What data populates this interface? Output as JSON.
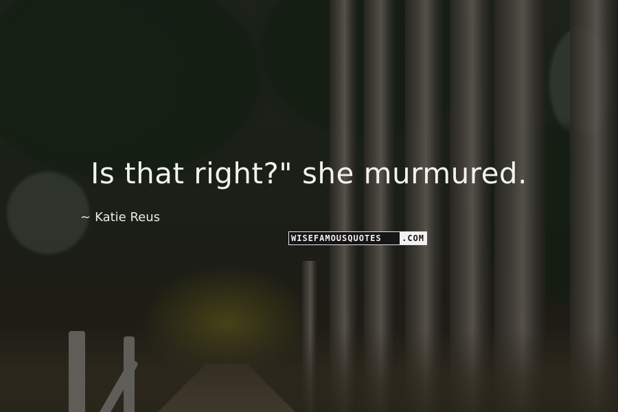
{
  "quote": {
    "text": "Is that right?\" she murmured.",
    "author_dash": "~",
    "author": "Katie Reus"
  },
  "watermark": {
    "part1": "WISEFAMOUSQUOTES",
    "part2": ".COM"
  },
  "colors": {
    "text": "#f2f2ee",
    "watermark_dark": "#161616",
    "watermark_light": "#f1f1f1"
  }
}
